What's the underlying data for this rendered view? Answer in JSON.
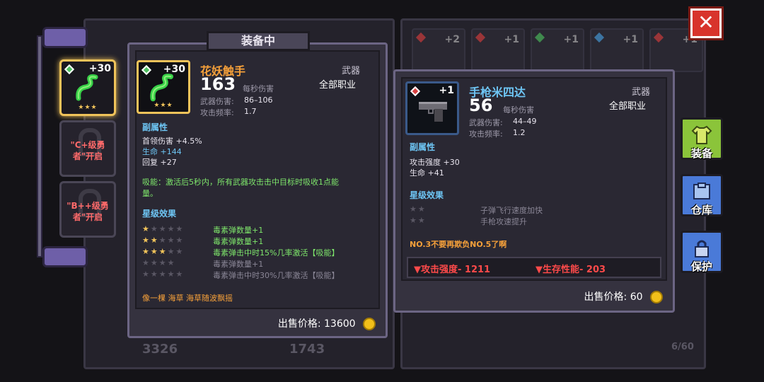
{
  "equipped_tab": "装备中",
  "left_column": {
    "slots": [
      {
        "plus": "+30",
        "stars": "★★★"
      },
      {
        "lock_text": "\"C+级勇者\"开启"
      },
      {
        "lock_text": "\"B++级勇者\"开启"
      }
    ]
  },
  "equipped": {
    "name": "花妖触手",
    "plus": "+30",
    "stars": "★★★",
    "dps": "163",
    "dps_label": "每秒伤害",
    "type": "武器",
    "class": "全部职业",
    "damage_label": "武器伤害:",
    "damage": "86–106",
    "rate_label": "攻击频率:",
    "rate": "1.7",
    "sub_title": "副属性",
    "sub_stats": [
      "首领伤害 +4.5%",
      "生命 +144",
      "回复 +27"
    ],
    "skill": "吸能：激活后5秒内，所有武器攻击击中目标时吸收1点能量。",
    "skill_line1": "吸能：激活后5秒内，所有武器攻击击中目标时吸收1点能",
    "skill_line2": "量。",
    "star_title": "星级效果",
    "star_effects": [
      {
        "text": "毒素弹数量+1",
        "on": 1
      },
      {
        "text": "毒素弹数量+1",
        "on": 2
      },
      {
        "text": "毒素弹击中时15%几率激活【吸能】",
        "on": 3
      },
      {
        "text": "毒素弹数量+1",
        "on": 0
      },
      {
        "text": "毒素弹击中时30%几率激活【吸能】",
        "on": 0
      }
    ],
    "flavor": "像一棵 海草 海草随波飘摇",
    "sell_label": "出售价格:",
    "sell_price": "13600"
  },
  "compare": {
    "name": "手枪米四达",
    "plus": "+1",
    "dps": "56",
    "dps_label": "每秒伤害",
    "type": "武器",
    "class": "全部职业",
    "damage_label": "武器伤害:",
    "damage": "44–49",
    "rate_label": "攻击频率:",
    "rate": "1.2",
    "sub_title": "副属性",
    "sub_stats": [
      "攻击强度 +30",
      "生命 +41"
    ],
    "star_title": "星级效果",
    "star_effects": [
      "子弹飞行速度加快",
      "手枪攻速提升"
    ],
    "note": "NO.3不要再欺负NO.5了啊",
    "diff_attack": "▼攻击强度- 1211",
    "diff_survive": "▼生存性能- 203",
    "sell_label": "出售价格:",
    "sell_price": "60"
  },
  "background": {
    "stat_a": "3326",
    "stat_b": "1743",
    "capacity": "6/60",
    "inv_pluses": [
      "+2",
      "+1",
      "+1",
      "+1",
      "+1"
    ]
  },
  "side_buttons": {
    "equip": "装备",
    "storage": "仓库",
    "protect": "保护"
  },
  "close": "✕",
  "colors": {
    "gold": "#f0c35a",
    "green": "#7ee66b",
    "blue": "#6ec6f5",
    "orange": "#f5a03a",
    "red": "#ff4a4a"
  }
}
